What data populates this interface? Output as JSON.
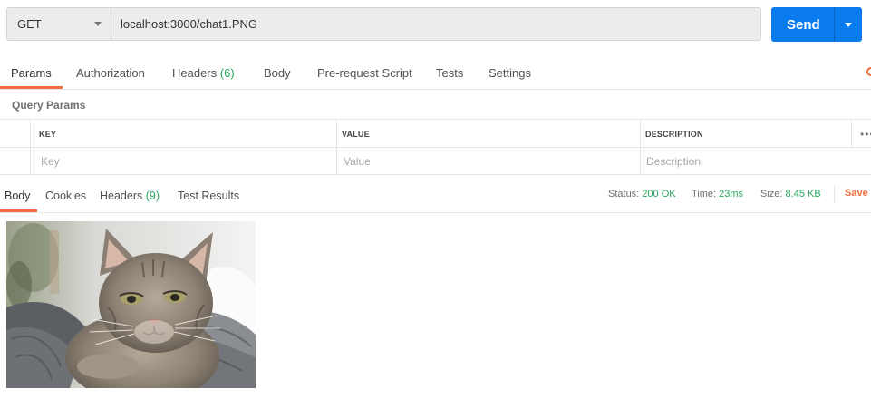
{
  "request": {
    "method": "GET",
    "url": "localhost:3000/chat1.PNG",
    "send_label": "Send"
  },
  "request_tabs": [
    {
      "label": "Params",
      "count": ""
    },
    {
      "label": "Authorization",
      "count": ""
    },
    {
      "label": "Headers",
      "count": "(6)"
    },
    {
      "label": "Body",
      "count": ""
    },
    {
      "label": "Pre-request Script",
      "count": ""
    },
    {
      "label": "Tests",
      "count": ""
    },
    {
      "label": "Settings",
      "count": ""
    }
  ],
  "query_params": {
    "title": "Query Params",
    "columns": [
      "KEY",
      "VALUE",
      "DESCRIPTION"
    ],
    "placeholders": {
      "key": "Key",
      "value": "Value",
      "description": "Description"
    },
    "more": "•••"
  },
  "response": {
    "tabs": [
      {
        "label": "Body",
        "count": ""
      },
      {
        "label": "Cookies",
        "count": ""
      },
      {
        "label": "Headers",
        "count": "(9)"
      },
      {
        "label": "Test Results",
        "count": ""
      }
    ],
    "status_label": "Status:",
    "status_value": "200 OK",
    "time_label": "Time:",
    "time_value": "23ms",
    "size_label": "Size:",
    "size_value": "8.45 KB",
    "save_label": "Save"
  },
  "colors": {
    "accent": "#f26b3a",
    "send": "#097bed",
    "success": "#26a65b"
  },
  "icons": {
    "method_dropdown": "chevron-down-icon",
    "send_dropdown": "chevron-down-icon",
    "more": "more-horizontal-icon"
  }
}
